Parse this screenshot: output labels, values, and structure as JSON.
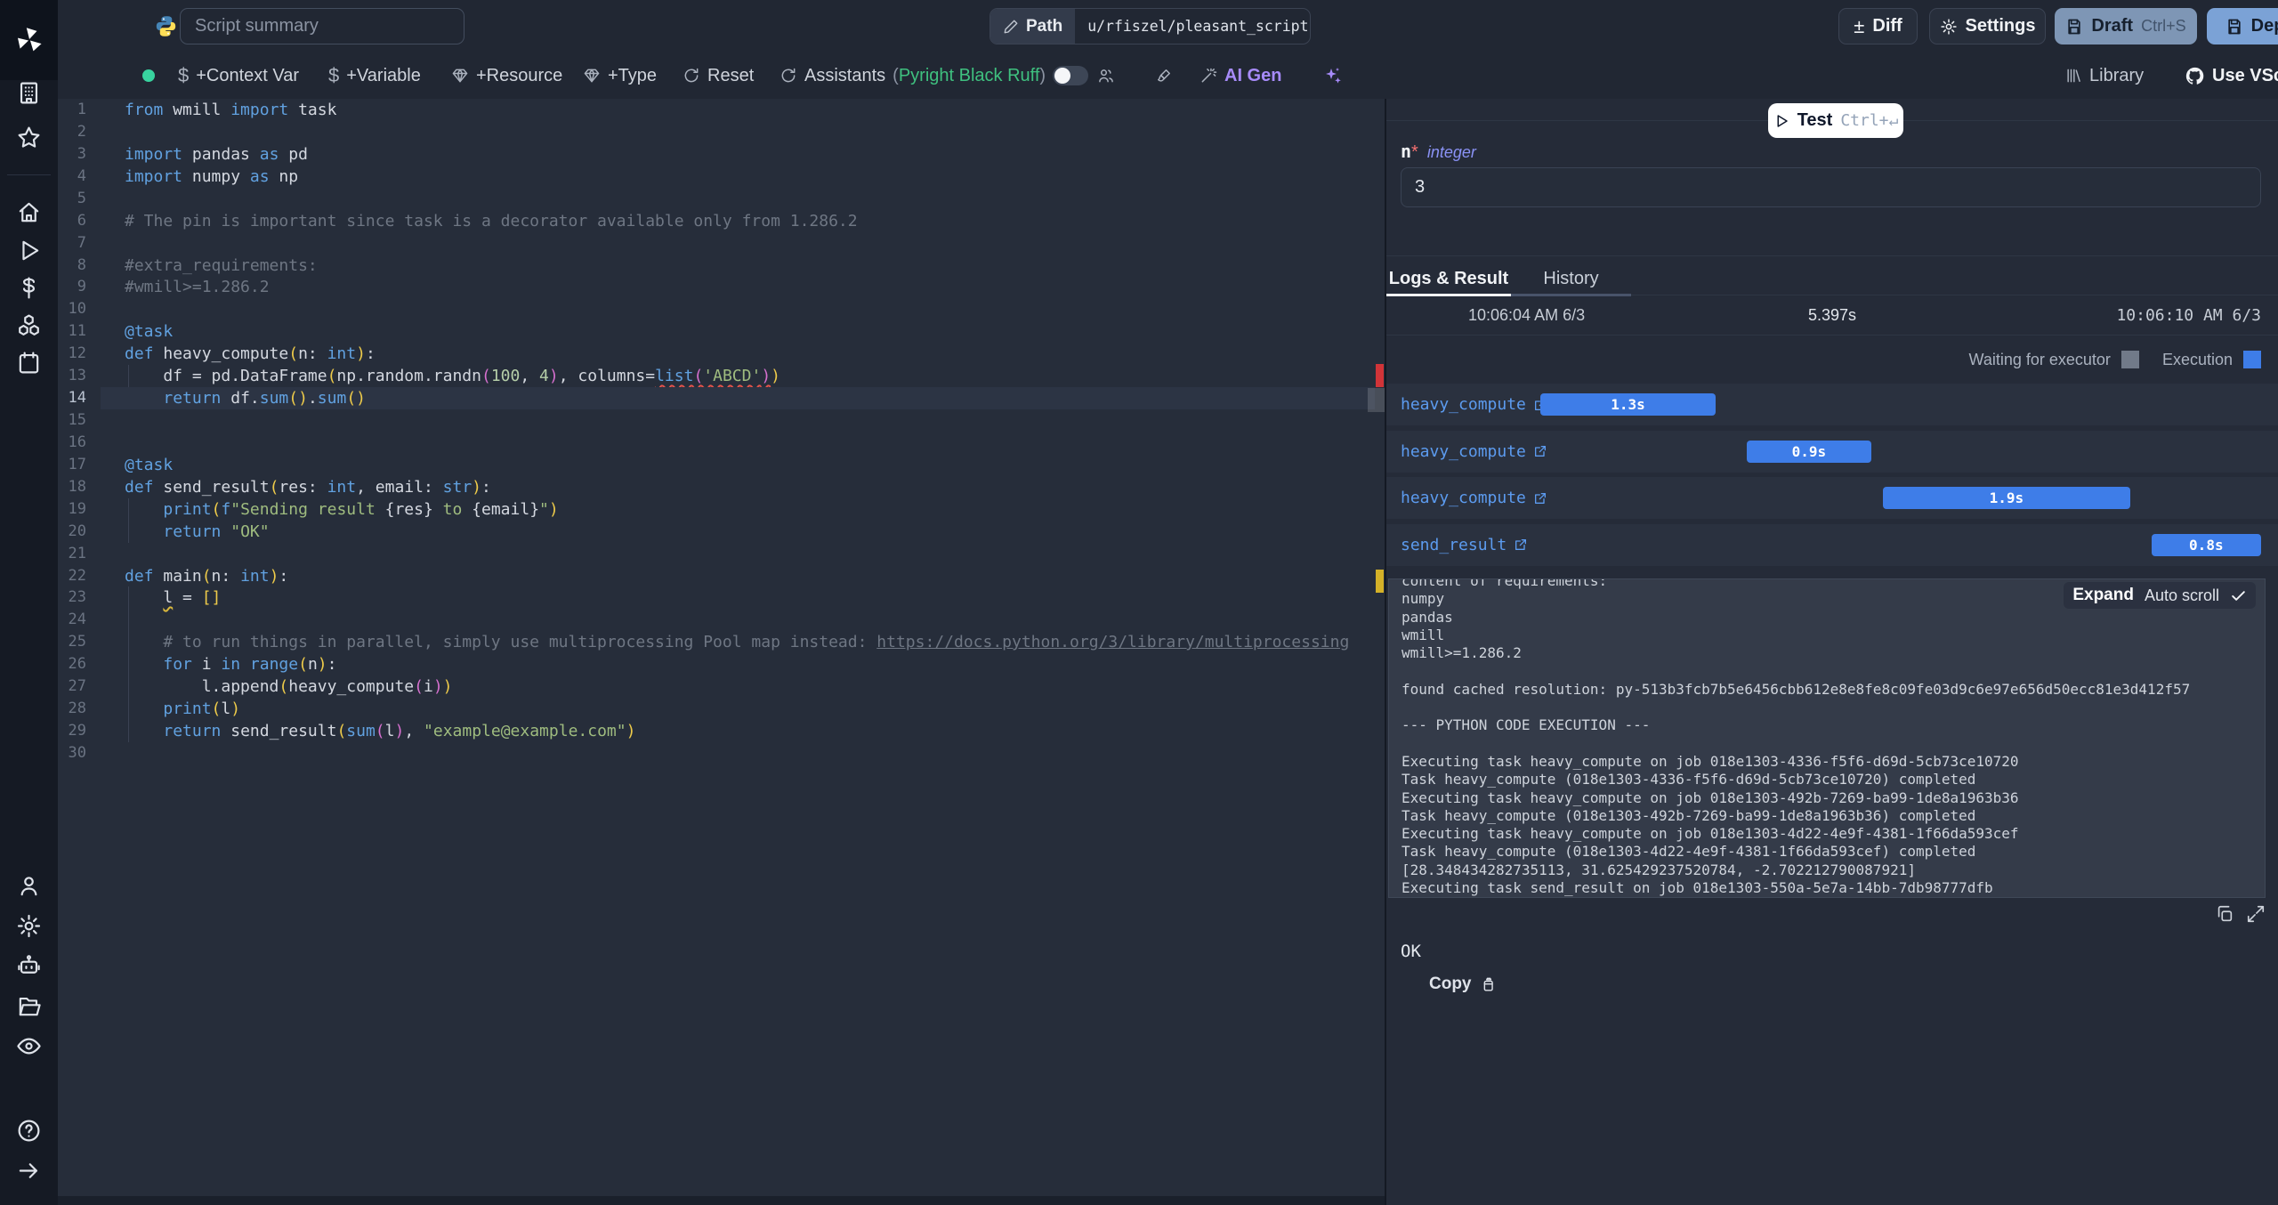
{
  "topbar": {
    "summary_placeholder": "Script summary",
    "path_label": "Path",
    "path_value": "u/rfiszel/pleasant_script",
    "diff": "Diff",
    "settings": "Settings",
    "draft": "Draft",
    "draft_shortcut": "Ctrl+S",
    "deploy": "Deploy"
  },
  "toolbar": {
    "context_var": "+Context Var",
    "variable": "+Variable",
    "resource": "+Resource",
    "type": "+Type",
    "reset": "Reset",
    "assistants": "Assistants",
    "paren_open": "(",
    "assistants_langs": "Pyright Black Ruff",
    "paren_close": ")",
    "ai_gen": "AI Gen",
    "library": "Library",
    "use_vscode": "Use VScode"
  },
  "sidebar": {
    "icons": [
      "buildings-icon",
      "star-icon",
      "home-icon",
      "play-icon",
      "dollar-icon",
      "resources-icon",
      "calendar-icon",
      "user-icon",
      "gear-icon",
      "robot-icon",
      "folder-icon",
      "eye-icon",
      "help-icon",
      "arrow-right-icon"
    ]
  },
  "editor": {
    "language_icon": "python-icon",
    "lines": [
      {
        "n": 1,
        "tokens": [
          [
            "k",
            "from"
          ],
          [
            "t",
            " wmill "
          ],
          [
            "k",
            "import"
          ],
          [
            "t",
            " task"
          ]
        ]
      },
      {
        "n": 2,
        "tokens": []
      },
      {
        "n": 3,
        "tokens": [
          [
            "k",
            "import"
          ],
          [
            "t",
            " pandas "
          ],
          [
            "k",
            "as"
          ],
          [
            "t",
            " pd"
          ]
        ]
      },
      {
        "n": 4,
        "tokens": [
          [
            "k",
            "import"
          ],
          [
            "t",
            " numpy "
          ],
          [
            "k",
            "as"
          ],
          [
            "t",
            " np"
          ]
        ]
      },
      {
        "n": 5,
        "tokens": []
      },
      {
        "n": 6,
        "tokens": [
          [
            "c",
            "# The pin is important since task is a decorator available only from 1.286.2"
          ]
        ]
      },
      {
        "n": 7,
        "tokens": []
      },
      {
        "n": 8,
        "tokens": [
          [
            "c",
            "#extra_requirements:"
          ]
        ]
      },
      {
        "n": 9,
        "tokens": [
          [
            "c",
            "#wmill>=1.286.2"
          ]
        ]
      },
      {
        "n": 10,
        "tokens": []
      },
      {
        "n": 11,
        "tokens": [
          [
            "k",
            "@task"
          ]
        ]
      },
      {
        "n": 12,
        "tokens": [
          [
            "k",
            "def"
          ],
          [
            "t",
            " heavy_compute"
          ],
          [
            "y",
            "("
          ],
          [
            "t",
            "n: "
          ],
          [
            "k",
            "int"
          ],
          [
            "y",
            ")"
          ],
          [
            "t",
            ":"
          ]
        ]
      },
      {
        "n": 13,
        "tokens": [
          [
            "t",
            "    df = pd.DataFrame"
          ],
          [
            "y",
            "("
          ],
          [
            "t",
            "np.random.randn"
          ],
          [
            "m",
            "("
          ],
          [
            "n",
            "100"
          ],
          [
            "t",
            ", "
          ],
          [
            "n",
            "4"
          ],
          [
            "m",
            ")"
          ],
          [
            "t",
            ", columns="
          ],
          [
            "k er",
            "list"
          ],
          [
            "m er",
            "("
          ],
          [
            "s er",
            "'ABCD'"
          ],
          [
            "m er",
            ")"
          ],
          [
            "y",
            ")"
          ]
        ]
      },
      {
        "n": 14,
        "current": true,
        "tokens": [
          [
            "t",
            "    "
          ],
          [
            "k",
            "return"
          ],
          [
            "t",
            " df."
          ],
          [
            "k",
            "sum"
          ],
          [
            "y",
            "()"
          ],
          [
            "t",
            "."
          ],
          [
            "k",
            "sum"
          ],
          [
            "y",
            "()"
          ]
        ]
      },
      {
        "n": 15,
        "tokens": []
      },
      {
        "n": 16,
        "tokens": []
      },
      {
        "n": 17,
        "tokens": [
          [
            "k",
            "@task"
          ]
        ]
      },
      {
        "n": 18,
        "tokens": [
          [
            "k",
            "def"
          ],
          [
            "t",
            " send_result"
          ],
          [
            "y",
            "("
          ],
          [
            "t",
            "res: "
          ],
          [
            "k",
            "int"
          ],
          [
            "t",
            ", email: "
          ],
          [
            "k",
            "str"
          ],
          [
            "y",
            ")"
          ],
          [
            "t",
            ":"
          ]
        ]
      },
      {
        "n": 19,
        "tokens": [
          [
            "t",
            "    "
          ],
          [
            "k",
            "print"
          ],
          [
            "y",
            "("
          ],
          [
            "k",
            "f"
          ],
          [
            "s",
            "\"Sending result "
          ],
          [
            "t",
            "{res}"
          ],
          [
            "s",
            " to "
          ],
          [
            "t",
            "{email}"
          ],
          [
            "s",
            "\""
          ],
          [
            "y",
            ")"
          ]
        ]
      },
      {
        "n": 20,
        "tokens": [
          [
            "t",
            "    "
          ],
          [
            "k",
            "return"
          ],
          [
            "t",
            " "
          ],
          [
            "s",
            "\"OK\""
          ]
        ]
      },
      {
        "n": 21,
        "tokens": []
      },
      {
        "n": 22,
        "tokens": [
          [
            "k",
            "def"
          ],
          [
            "t",
            " main"
          ],
          [
            "y",
            "("
          ],
          [
            "t",
            "n: "
          ],
          [
            "k",
            "int"
          ],
          [
            "y",
            ")"
          ],
          [
            "t",
            ":"
          ]
        ]
      },
      {
        "n": 23,
        "tokens": [
          [
            "t",
            "    "
          ],
          [
            "t ey",
            "l"
          ],
          [
            "t",
            " = "
          ],
          [
            "y",
            "[]"
          ]
        ]
      },
      {
        "n": 24,
        "tokens": []
      },
      {
        "n": 25,
        "tokens": [
          [
            "c",
            "    # to run things in parallel, simply use multiprocessing Pool map instead: "
          ],
          [
            "c u",
            "https://docs.python.org/3/library/multiprocessing"
          ]
        ]
      },
      {
        "n": 26,
        "tokens": [
          [
            "t",
            "    "
          ],
          [
            "k",
            "for"
          ],
          [
            "t",
            " i "
          ],
          [
            "k",
            "in"
          ],
          [
            "t",
            " "
          ],
          [
            "k",
            "range"
          ],
          [
            "y",
            "("
          ],
          [
            "t",
            "n"
          ],
          [
            "y",
            ")"
          ],
          [
            "t",
            ":"
          ]
        ]
      },
      {
        "n": 27,
        "tokens": [
          [
            "t",
            "        l.append"
          ],
          [
            "y",
            "("
          ],
          [
            "t",
            "heavy_compute"
          ],
          [
            "m",
            "("
          ],
          [
            "t",
            "i"
          ],
          [
            "m",
            ")"
          ],
          [
            "y",
            ")"
          ]
        ]
      },
      {
        "n": 28,
        "tokens": [
          [
            "t",
            "    "
          ],
          [
            "k",
            "print"
          ],
          [
            "y",
            "("
          ],
          [
            "t",
            "l"
          ],
          [
            "y",
            ")"
          ]
        ]
      },
      {
        "n": 29,
        "tokens": [
          [
            "t",
            "    "
          ],
          [
            "k",
            "return"
          ],
          [
            "t",
            " send_result"
          ],
          [
            "y",
            "("
          ],
          [
            "k",
            "sum"
          ],
          [
            "m",
            "("
          ],
          [
            "t",
            "l"
          ],
          [
            "m",
            ")"
          ],
          [
            "t",
            ", "
          ],
          [
            "s",
            "\"example@example.com\""
          ],
          [
            "y",
            ")"
          ]
        ]
      },
      {
        "n": 30,
        "tokens": []
      }
    ]
  },
  "runner": {
    "test_label": "Test",
    "test_shortcut": "Ctrl+↵",
    "arg_name": "n",
    "arg_required": "*",
    "arg_type": "integer",
    "arg_value": "3",
    "tabs": [
      "Logs & Result",
      "History"
    ],
    "start_time": "10:06:04 AM 6/3",
    "duration": "5.397s",
    "end_time": "10:06:10 AM 6/3",
    "legend_waiting": "Waiting for executor",
    "legend_execution": "Execution",
    "timeline": [
      {
        "name": "heavy_compute",
        "duration": "1.3s",
        "left_pct": 17.3,
        "width_pct": 19.6
      },
      {
        "name": "heavy_compute",
        "duration": "0.9s",
        "left_pct": 40.4,
        "width_pct": 14.0
      },
      {
        "name": "heavy_compute",
        "duration": "1.9s",
        "left_pct": 55.7,
        "width_pct": 27.7
      },
      {
        "name": "send_result",
        "duration": "0.8s",
        "left_pct": 85.8,
        "width_pct": 12.3
      }
    ],
    "logs": {
      "expand_label": "Expand",
      "autoscroll_label": "Auto scroll",
      "lines": [
        "content of requirements:",
        "numpy",
        "pandas",
        "wmill",
        "wmill>=1.286.2",
        "",
        "found cached resolution: py-513b3fcb7b5e6456cbb612e8e8fe8c09fe03d9c6e97e656d50ecc81e3d412f57",
        "",
        "--- PYTHON CODE EXECUTION ---",
        "",
        "Executing task heavy_compute on job 018e1303-4336-f5f6-d69d-5cb73ce10720",
        "Task heavy_compute (018e1303-4336-f5f6-d69d-5cb73ce10720) completed",
        "Executing task heavy_compute on job 018e1303-492b-7269-ba99-1de8a1963b36",
        "Task heavy_compute (018e1303-492b-7269-ba99-1de8a1963b36) completed",
        "Executing task heavy_compute on job 018e1303-4d22-4e9f-4381-1f66da593cef",
        "Task heavy_compute (018e1303-4d22-4e9f-4381-1f66da593cef) completed",
        "[28.348434282735113, 31.625429237520784, -2.702212790087921]",
        "Executing task send_result on job 018e1303-550a-5e7a-14bb-7db98777dfb"
      ]
    },
    "result_value": "OK",
    "copy_label": "Copy"
  },
  "colors": {
    "accent_blue": "#3e7de8",
    "link_blue": "#5c9bef",
    "success_green": "#3fc07f",
    "ai_purple": "#a78bfa",
    "error_red": "#e5534b",
    "warning_yellow": "#d9b83c",
    "draft_button": "#7e96b5",
    "deploy_button": "#7ba2d6"
  }
}
